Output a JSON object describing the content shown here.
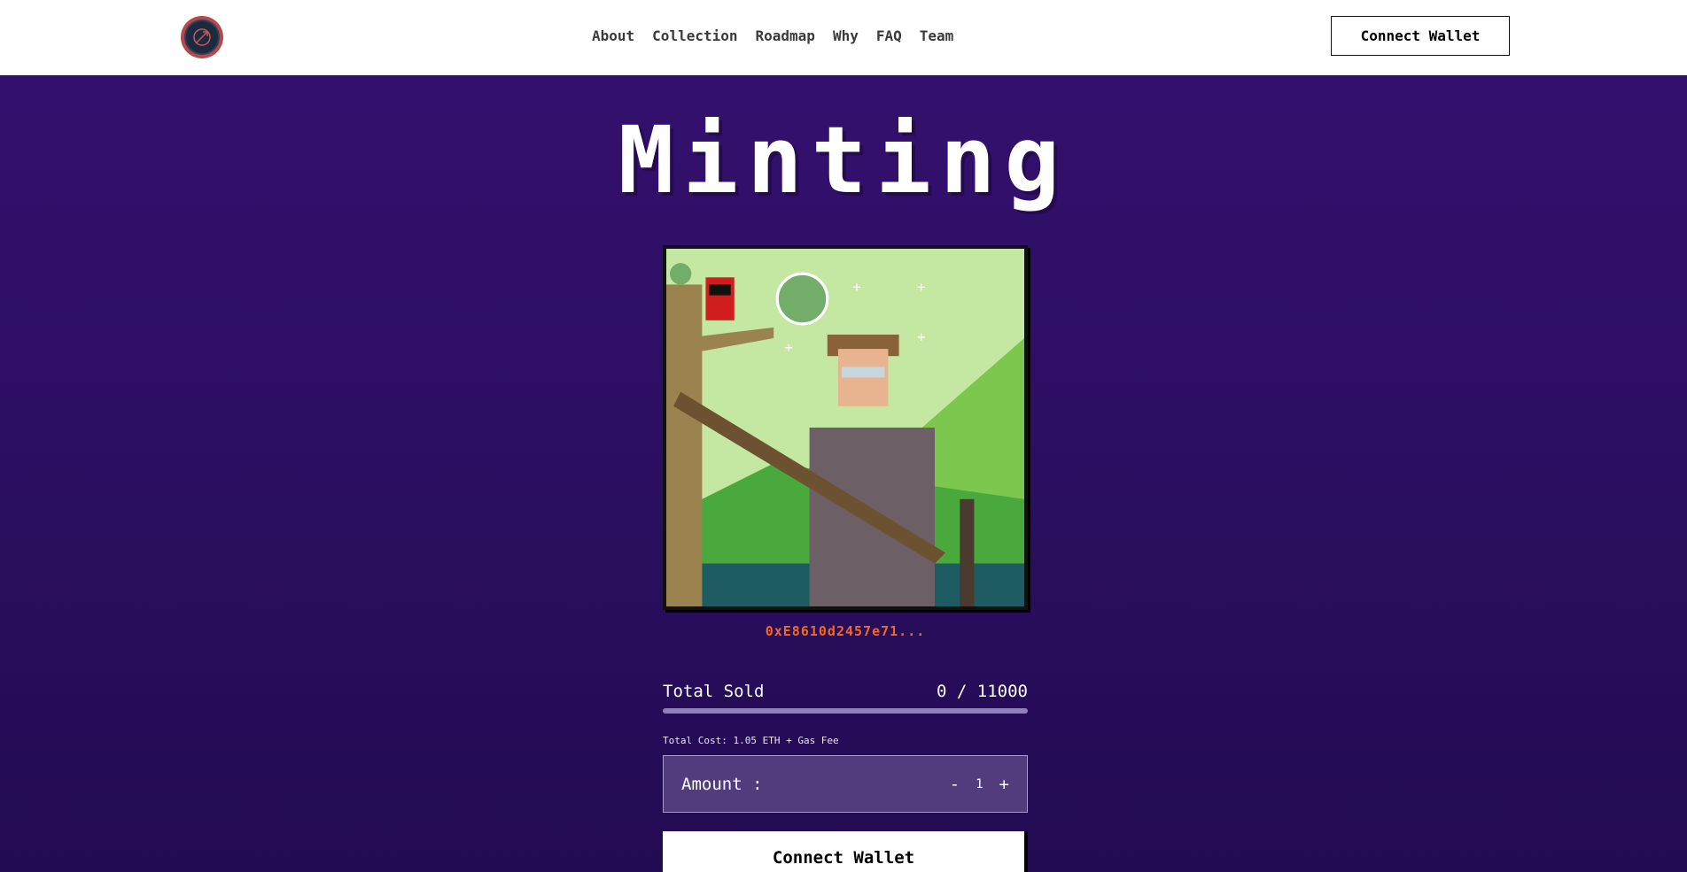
{
  "header": {
    "nav": [
      "About",
      "Collection",
      "Roadmap",
      "Why",
      "FAQ",
      "Team"
    ],
    "connect_label": "Connect Wallet"
  },
  "hero": {
    "title": "Minting",
    "contract_address": "0xE8610d2457e71..."
  },
  "sales": {
    "label": "Total Sold",
    "count": "0 / 11000",
    "sold": 0,
    "total": 11000,
    "cost_text": "Total Cost: 1.05 ETH + Gas Fee"
  },
  "amount": {
    "label": "Amount :",
    "minus": "-",
    "value": "1",
    "plus": "+"
  },
  "mint": {
    "connect_label": "Connect Wallet"
  },
  "colors": {
    "bg_top": "#351070",
    "accent": "#f26a21",
    "panel": "#523c7d"
  },
  "icons": {
    "logo": "bow-arrow-logo-icon"
  }
}
